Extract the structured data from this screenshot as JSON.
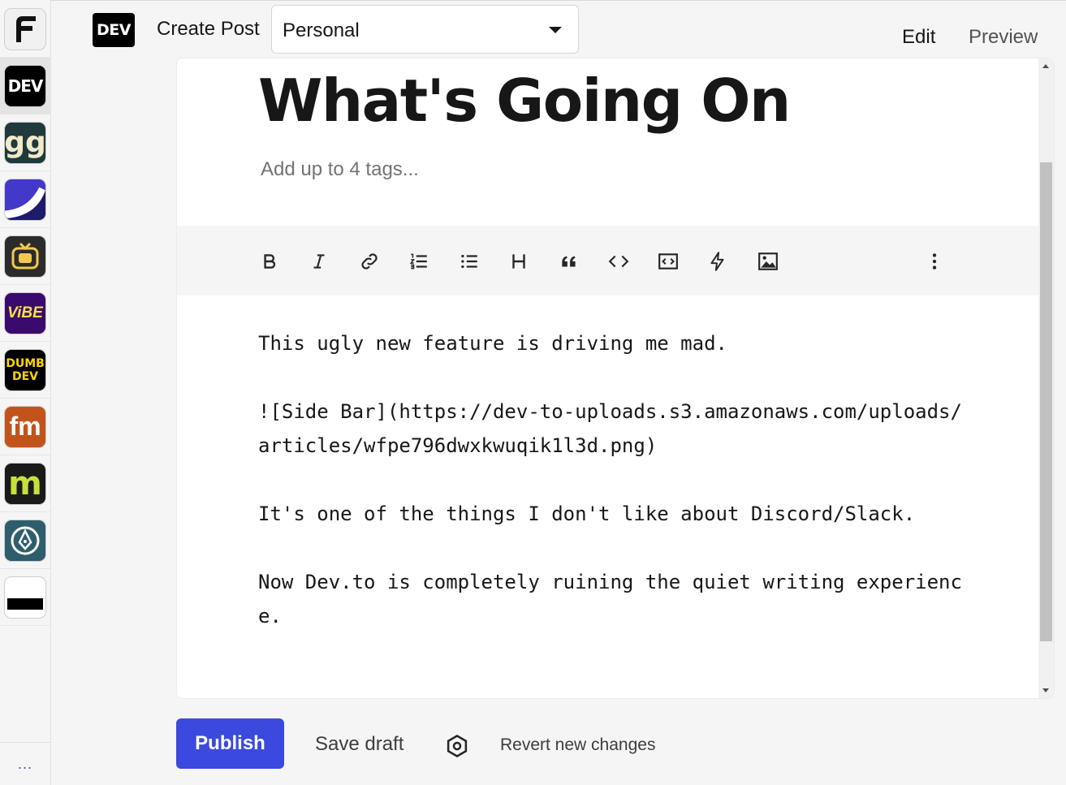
{
  "rail": {
    "apps": [
      {
        "name": "forem",
        "label": "F",
        "bg": "#f0f0f0",
        "fg": "#111111"
      },
      {
        "name": "dev",
        "label": "DEV",
        "bg": "#000000",
        "fg": "#ffffff"
      },
      {
        "name": "gg",
        "label": "gg",
        "bg": "#1f3a3d",
        "fg": "#f2e9c9"
      },
      {
        "name": "swoosh",
        "label": "",
        "bg": "#4338ca",
        "fg": "#ffffff"
      },
      {
        "name": "tv",
        "label": "",
        "bg": "#2b2b2b",
        "fg": "#f2c94c"
      },
      {
        "name": "vibe",
        "label": "ViBE",
        "bg": "#3b0a6e",
        "fg": "#f5e04b"
      },
      {
        "name": "dumb-dev",
        "label": "DUMB DEV",
        "bg": "#000000",
        "fg": "#ffd500"
      },
      {
        "name": "fm",
        "label": "fm",
        "bg": "#c2541b",
        "fg": "#ffffff"
      },
      {
        "name": "m",
        "label": "m",
        "bg": "#1a1a1a",
        "fg": "#c7df3a"
      },
      {
        "name": "pen",
        "label": "",
        "bg": "#2e5e6b",
        "fg": "#ffffff"
      },
      {
        "name": "black-bar",
        "label": "",
        "bg": "#ffffff",
        "fg": "#000000"
      }
    ],
    "more_label": "..."
  },
  "header": {
    "logo": "DEV",
    "create_post": "Create Post",
    "org_select_value": "Personal",
    "tab_edit": "Edit",
    "tab_preview": "Preview"
  },
  "editor": {
    "title": "What's Going On",
    "tags_placeholder": "Add up to 4 tags...",
    "toolbar": [
      "bold",
      "italic",
      "link",
      "ordered-list",
      "unordered-list",
      "heading",
      "quote",
      "code",
      "code-block",
      "embed",
      "image",
      "more"
    ],
    "body": "This ugly new feature is driving me mad.\n\n![Side Bar](https://dev-to-uploads.s3.amazonaws.com/uploads/articles/wfpe796dwxkwuqik1l3d.png)\n\nIt's one of the things I don't like about Discord/Slack.\n\nNow Dev.to is completely ruining the quiet writing experience."
  },
  "footer": {
    "publish": "Publish",
    "save_draft": "Save draft",
    "revert": "Revert new changes"
  },
  "colors": {
    "accent": "#3b49df"
  }
}
